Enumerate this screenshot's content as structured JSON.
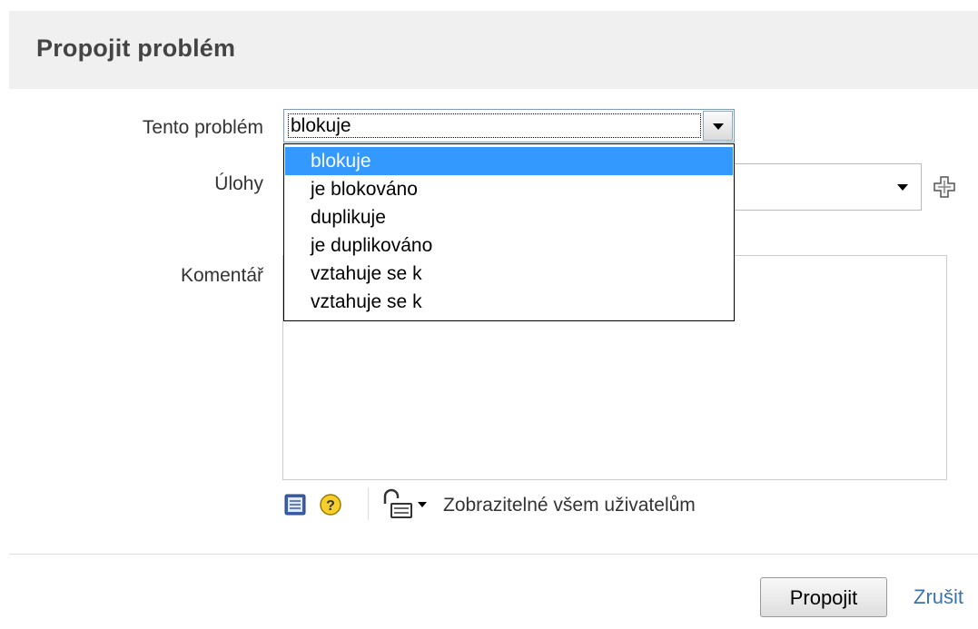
{
  "dialog": {
    "title": "Propojit problém"
  },
  "form": {
    "link_type": {
      "label": "Tento problém",
      "value": "blokuje",
      "options": [
        "blokuje",
        "je blokováno",
        "duplikuje",
        "je duplikováno",
        "vztahuje se k",
        "vztahuje se k"
      ],
      "highlighted_index": 0
    },
    "issues": {
      "label": "Úlohy",
      "value": "",
      "arrow_icon": "chevron-down-icon",
      "add_icon": "plus-icon"
    },
    "comment": {
      "label": "Komentář",
      "value": "",
      "toolbar": {
        "wiki_icon": "wiki-markup-icon",
        "help_icon": "help-icon",
        "security_icon": "lock-icon",
        "visibility_label": "Zobrazitelné všem uživatelům"
      }
    }
  },
  "actions": {
    "submit_label": "Propojit",
    "cancel_label": "Zrušit"
  },
  "colors": {
    "header_bg": "#f0f0f0",
    "selection": "#3399ff",
    "link": "#3b73af"
  }
}
